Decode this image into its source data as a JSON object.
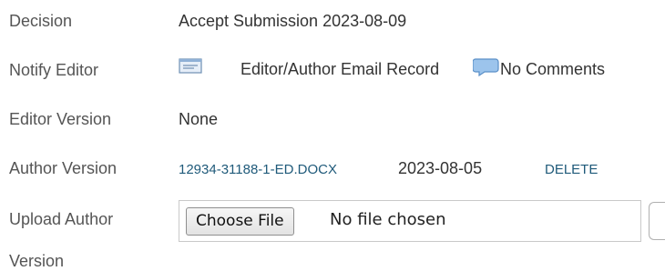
{
  "rows": {
    "decision": {
      "label": "Decision",
      "value": "Accept Submission 2023-08-09"
    },
    "notify_editor": {
      "label": "Notify Editor",
      "email_icon": "envelope-icon",
      "email_record": "Editor/Author Email Record",
      "comments_icon": "speech-bubble-icon",
      "comments": "No Comments"
    },
    "editor_version": {
      "label": "Editor Version",
      "value": "None"
    },
    "author_version": {
      "label": "Author Version",
      "file_link": "12934-31188-1-ED.DOCX",
      "date": "2023-08-05",
      "delete_link": "DELETE"
    },
    "upload_author_version": {
      "label_line1": "Upload Author",
      "label_line2": "Version",
      "choose_file_button": "Choose File",
      "no_file_text": "No file chosen"
    }
  }
}
